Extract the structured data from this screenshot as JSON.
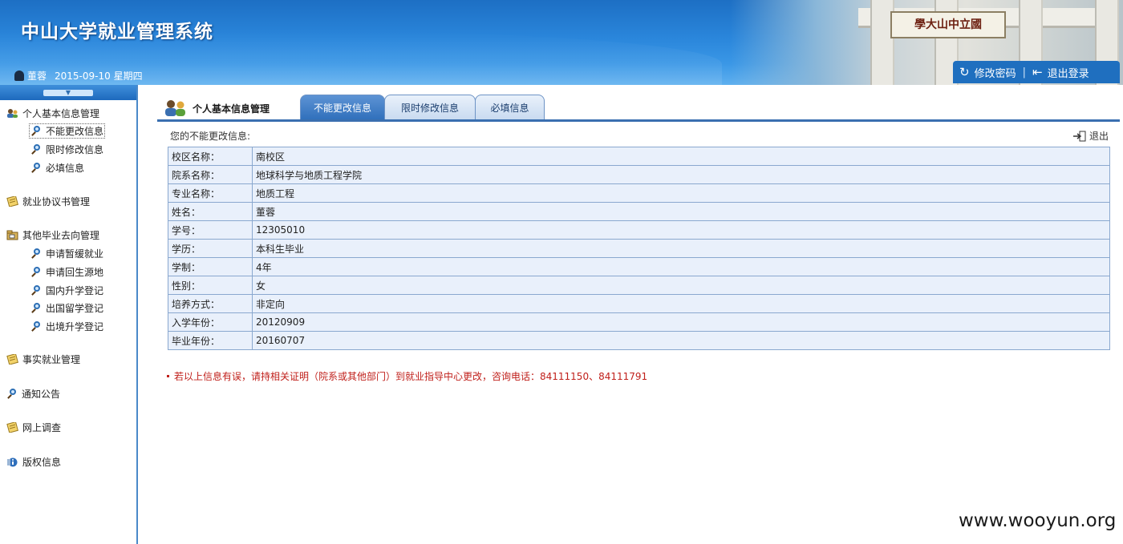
{
  "header": {
    "title": "中山大学就业管理系统",
    "user": "董蓉",
    "date": "2015-09-10 星期四",
    "plaque_text": "學大山中立國",
    "buttons": {
      "change_password": "修改密码",
      "logout": "退出登录",
      "separator": "|"
    }
  },
  "sidebar": {
    "groups": [
      {
        "label": "个人基本信息管理",
        "icon": "users-icon",
        "items": [
          "不能更改信息",
          "限时修改信息",
          "必填信息"
        ]
      },
      {
        "label": "就业协议书管理",
        "icon": "notepad-icon",
        "items": []
      },
      {
        "label": "其他毕业去向管理",
        "icon": "folder-icon",
        "items": [
          "申请暂缓就业",
          "申请回生源地",
          "国内升学登记",
          "出国留学登记",
          "出境升学登记"
        ]
      },
      {
        "label": "事实就业管理",
        "icon": "notepad-icon",
        "items": []
      },
      {
        "label": "通知公告",
        "icon": "magnifier-icon",
        "items": []
      },
      {
        "label": "网上调查",
        "icon": "notepad-icon",
        "items": []
      },
      {
        "label": "版权信息",
        "icon": "info-icon",
        "items": []
      }
    ]
  },
  "main": {
    "section_title": "个人基本信息管理",
    "tabs": [
      "不能更改信息",
      "限时修改信息",
      "必填信息"
    ],
    "active_tab": 0,
    "header_text": "您的不能更改信息:",
    "exit_label": "退出",
    "rows": [
      {
        "label": "校区名称：",
        "value": "南校区"
      },
      {
        "label": "院系名称：",
        "value": "地球科学与地质工程学院"
      },
      {
        "label": "专业名称：",
        "value": "地质工程"
      },
      {
        "label": "姓名：",
        "value": "董蓉"
      },
      {
        "label": "学号：",
        "value": "12305010"
      },
      {
        "label": "学历：",
        "value": "本科生毕业"
      },
      {
        "label": "学制：",
        "value": "4年"
      },
      {
        "label": "性别：",
        "value": "女"
      },
      {
        "label": "培养方式：",
        "value": "非定向"
      },
      {
        "label": "入学年份：",
        "value": "20120909"
      },
      {
        "label": "毕业年份：",
        "value": "20160707"
      }
    ],
    "note": "若以上信息有误，请持相关证明（院系或其他部门）到就业指导中心更改，咨询电话：84111150、84111791"
  },
  "watermark": "www.wooyun.org",
  "colors": {
    "header_blue": "#2a86db",
    "tab_active": "#2f6fbb",
    "table_bg": "#e9f0fb",
    "note_red": "#c0201b"
  }
}
